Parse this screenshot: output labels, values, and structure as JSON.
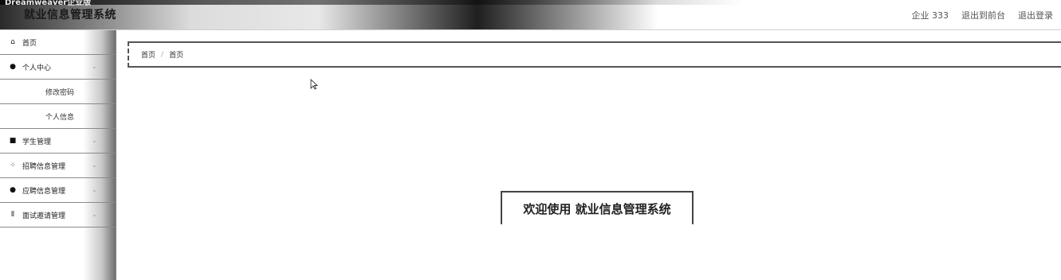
{
  "window": {
    "faint_title": "Dreamweaver企业版"
  },
  "header": {
    "app_title": "就业信息管理系统",
    "user_label": "企业 333",
    "front_link": "退出到前台",
    "logout_link": "退出登录"
  },
  "sidebar": {
    "items": [
      {
        "label": "首页",
        "icon": "home-icon",
        "glyph": "⌂"
      },
      {
        "label": "个人中心",
        "icon": "user-icon",
        "glyph": "●"
      },
      {
        "label": "学生管理",
        "icon": "camera-icon",
        "glyph": "■"
      },
      {
        "label": "招聘信息管理",
        "icon": "grid-icon",
        "glyph": "⁘"
      },
      {
        "label": "应聘信息管理",
        "icon": "location-icon",
        "glyph": "●"
      },
      {
        "label": "面试邀请管理",
        "icon": "bars-icon",
        "glyph": "⦀"
      }
    ],
    "sub_items": [
      {
        "label": "修改密码"
      },
      {
        "label": "个人信息"
      }
    ],
    "chevron": "⌄"
  },
  "breadcrumb": {
    "root": "首页",
    "separator": "/",
    "current": "首页"
  },
  "main": {
    "welcome_text": "欢迎使用 就业信息管理系统"
  }
}
